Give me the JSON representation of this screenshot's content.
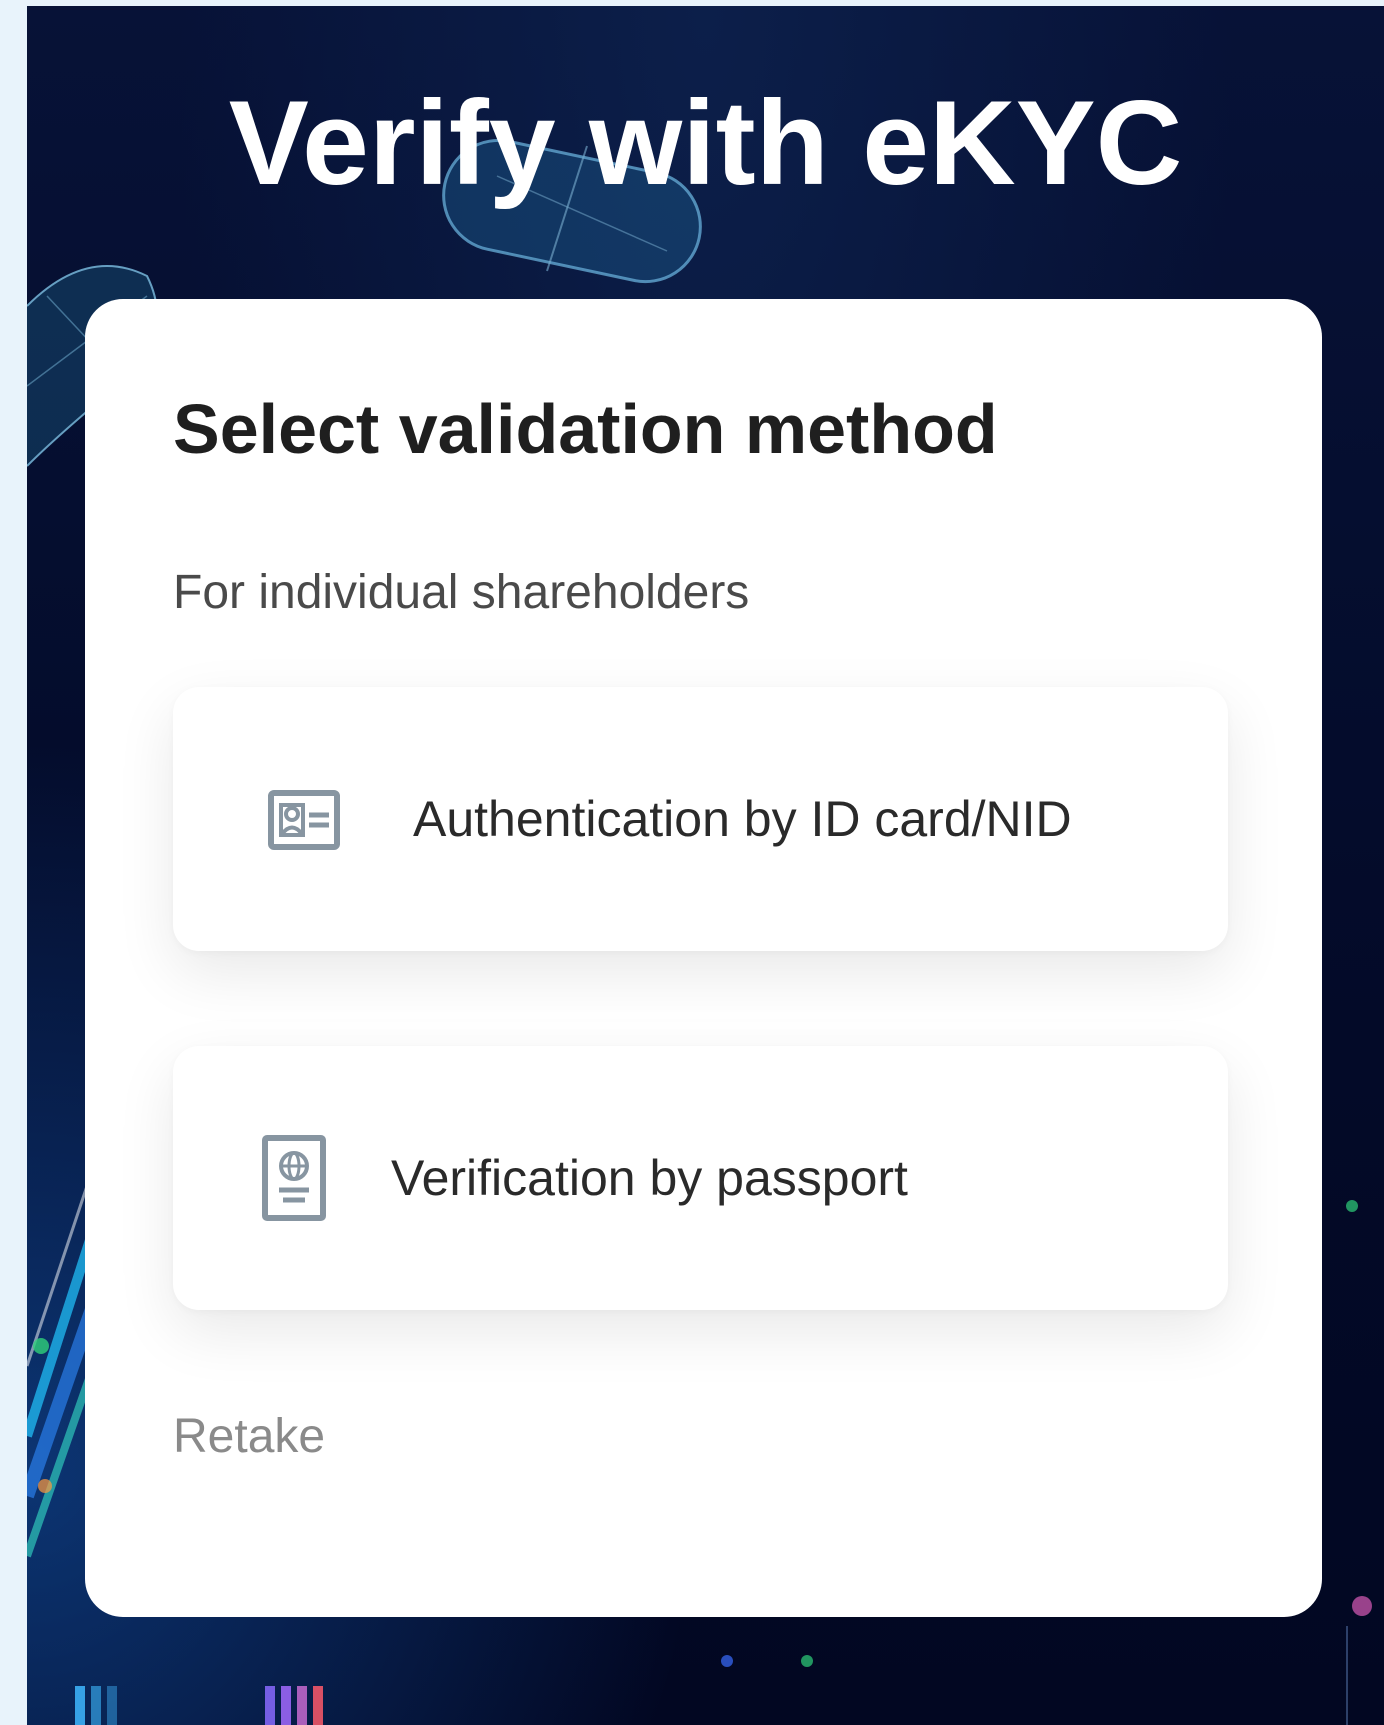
{
  "page": {
    "title": "Verify with eKYC"
  },
  "card": {
    "title": "Select validation method",
    "subtitle": "For individual shareholders",
    "options": [
      {
        "label": "Authentication by ID card/NID",
        "icon": "id-card-icon"
      },
      {
        "label": "Verification by passport",
        "icon": "passport-icon"
      }
    ],
    "retake_label": "Retake"
  },
  "colors": {
    "background": "#071237",
    "card": "#ffffff",
    "title_text": "#ffffff",
    "heading_text": "#1f1f1f",
    "icon": "#8795a1",
    "muted_text": "#8a8a8a"
  }
}
